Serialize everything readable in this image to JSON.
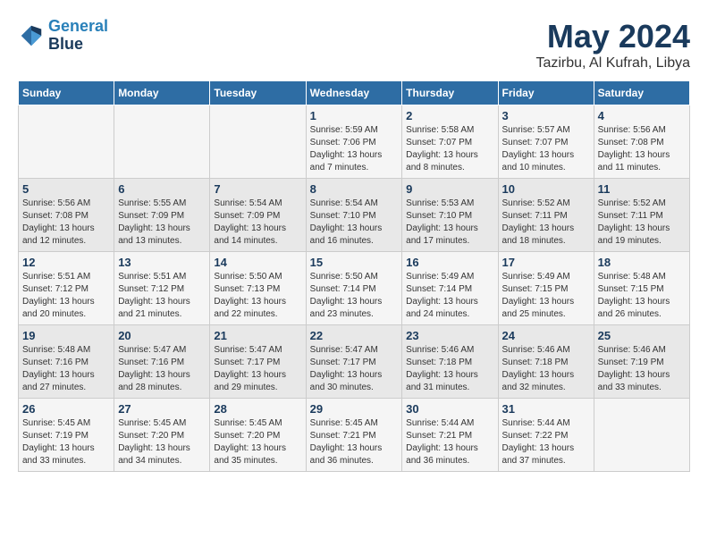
{
  "logo": {
    "line1": "General",
    "line2": "Blue"
  },
  "title": "May 2024",
  "location": "Tazirbu, Al Kufrah, Libya",
  "days_of_week": [
    "Sunday",
    "Monday",
    "Tuesday",
    "Wednesday",
    "Thursday",
    "Friday",
    "Saturday"
  ],
  "weeks": [
    [
      {
        "day": "",
        "info": ""
      },
      {
        "day": "",
        "info": ""
      },
      {
        "day": "",
        "info": ""
      },
      {
        "day": "1",
        "info": "Sunrise: 5:59 AM\nSunset: 7:06 PM\nDaylight: 13 hours\nand 7 minutes."
      },
      {
        "day": "2",
        "info": "Sunrise: 5:58 AM\nSunset: 7:07 PM\nDaylight: 13 hours\nand 8 minutes."
      },
      {
        "day": "3",
        "info": "Sunrise: 5:57 AM\nSunset: 7:07 PM\nDaylight: 13 hours\nand 10 minutes."
      },
      {
        "day": "4",
        "info": "Sunrise: 5:56 AM\nSunset: 7:08 PM\nDaylight: 13 hours\nand 11 minutes."
      }
    ],
    [
      {
        "day": "5",
        "info": "Sunrise: 5:56 AM\nSunset: 7:08 PM\nDaylight: 13 hours\nand 12 minutes."
      },
      {
        "day": "6",
        "info": "Sunrise: 5:55 AM\nSunset: 7:09 PM\nDaylight: 13 hours\nand 13 minutes."
      },
      {
        "day": "7",
        "info": "Sunrise: 5:54 AM\nSunset: 7:09 PM\nDaylight: 13 hours\nand 14 minutes."
      },
      {
        "day": "8",
        "info": "Sunrise: 5:54 AM\nSunset: 7:10 PM\nDaylight: 13 hours\nand 16 minutes."
      },
      {
        "day": "9",
        "info": "Sunrise: 5:53 AM\nSunset: 7:10 PM\nDaylight: 13 hours\nand 17 minutes."
      },
      {
        "day": "10",
        "info": "Sunrise: 5:52 AM\nSunset: 7:11 PM\nDaylight: 13 hours\nand 18 minutes."
      },
      {
        "day": "11",
        "info": "Sunrise: 5:52 AM\nSunset: 7:11 PM\nDaylight: 13 hours\nand 19 minutes."
      }
    ],
    [
      {
        "day": "12",
        "info": "Sunrise: 5:51 AM\nSunset: 7:12 PM\nDaylight: 13 hours\nand 20 minutes."
      },
      {
        "day": "13",
        "info": "Sunrise: 5:51 AM\nSunset: 7:12 PM\nDaylight: 13 hours\nand 21 minutes."
      },
      {
        "day": "14",
        "info": "Sunrise: 5:50 AM\nSunset: 7:13 PM\nDaylight: 13 hours\nand 22 minutes."
      },
      {
        "day": "15",
        "info": "Sunrise: 5:50 AM\nSunset: 7:14 PM\nDaylight: 13 hours\nand 23 minutes."
      },
      {
        "day": "16",
        "info": "Sunrise: 5:49 AM\nSunset: 7:14 PM\nDaylight: 13 hours\nand 24 minutes."
      },
      {
        "day": "17",
        "info": "Sunrise: 5:49 AM\nSunset: 7:15 PM\nDaylight: 13 hours\nand 25 minutes."
      },
      {
        "day": "18",
        "info": "Sunrise: 5:48 AM\nSunset: 7:15 PM\nDaylight: 13 hours\nand 26 minutes."
      }
    ],
    [
      {
        "day": "19",
        "info": "Sunrise: 5:48 AM\nSunset: 7:16 PM\nDaylight: 13 hours\nand 27 minutes."
      },
      {
        "day": "20",
        "info": "Sunrise: 5:47 AM\nSunset: 7:16 PM\nDaylight: 13 hours\nand 28 minutes."
      },
      {
        "day": "21",
        "info": "Sunrise: 5:47 AM\nSunset: 7:17 PM\nDaylight: 13 hours\nand 29 minutes."
      },
      {
        "day": "22",
        "info": "Sunrise: 5:47 AM\nSunset: 7:17 PM\nDaylight: 13 hours\nand 30 minutes."
      },
      {
        "day": "23",
        "info": "Sunrise: 5:46 AM\nSunset: 7:18 PM\nDaylight: 13 hours\nand 31 minutes."
      },
      {
        "day": "24",
        "info": "Sunrise: 5:46 AM\nSunset: 7:18 PM\nDaylight: 13 hours\nand 32 minutes."
      },
      {
        "day": "25",
        "info": "Sunrise: 5:46 AM\nSunset: 7:19 PM\nDaylight: 13 hours\nand 33 minutes."
      }
    ],
    [
      {
        "day": "26",
        "info": "Sunrise: 5:45 AM\nSunset: 7:19 PM\nDaylight: 13 hours\nand 33 minutes."
      },
      {
        "day": "27",
        "info": "Sunrise: 5:45 AM\nSunset: 7:20 PM\nDaylight: 13 hours\nand 34 minutes."
      },
      {
        "day": "28",
        "info": "Sunrise: 5:45 AM\nSunset: 7:20 PM\nDaylight: 13 hours\nand 35 minutes."
      },
      {
        "day": "29",
        "info": "Sunrise: 5:45 AM\nSunset: 7:21 PM\nDaylight: 13 hours\nand 36 minutes."
      },
      {
        "day": "30",
        "info": "Sunrise: 5:44 AM\nSunset: 7:21 PM\nDaylight: 13 hours\nand 36 minutes."
      },
      {
        "day": "31",
        "info": "Sunrise: 5:44 AM\nSunset: 7:22 PM\nDaylight: 13 hours\nand 37 minutes."
      },
      {
        "day": "",
        "info": ""
      }
    ]
  ]
}
